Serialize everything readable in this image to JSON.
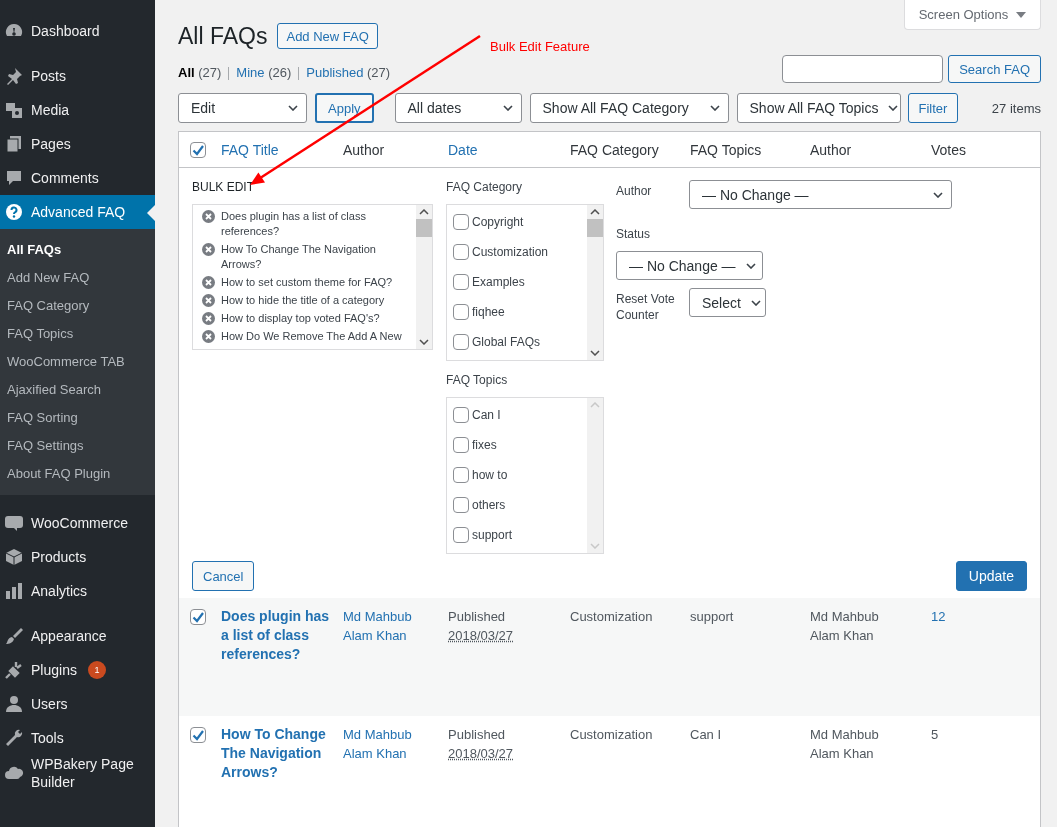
{
  "sidebar": {
    "groups": [
      {
        "items": [
          {
            "label": "Dashboard",
            "selected": false
          }
        ]
      },
      {
        "items": [
          {
            "label": "Posts",
            "selected": false
          },
          {
            "label": "Media",
            "selected": false
          },
          {
            "label": "Pages",
            "selected": false
          },
          {
            "label": "Comments",
            "selected": false
          },
          {
            "label": "Advanced FAQ",
            "selected": true,
            "children": [
              {
                "label": "All FAQs",
                "selected": true
              },
              {
                "label": "Add New FAQ",
                "selected": false
              },
              {
                "label": "FAQ Category",
                "selected": false
              },
              {
                "label": "FAQ Topics",
                "selected": false
              },
              {
                "label": "WooCommerce TAB",
                "selected": false
              },
              {
                "label": "Ajaxified Search",
                "selected": false
              },
              {
                "label": "FAQ Sorting",
                "selected": false
              },
              {
                "label": "FAQ Settings",
                "selected": false
              },
              {
                "label": "About FAQ Plugin",
                "selected": false
              }
            ]
          }
        ]
      },
      {
        "items": [
          {
            "label": "WooCommerce",
            "selected": false
          },
          {
            "label": "Products",
            "selected": false
          },
          {
            "label": "Analytics",
            "selected": false
          }
        ]
      },
      {
        "items": [
          {
            "label": "Appearance",
            "selected": false
          },
          {
            "label": "Plugins",
            "selected": false,
            "badge": "1"
          },
          {
            "label": "Users",
            "selected": false
          },
          {
            "label": "Tools",
            "selected": false
          },
          {
            "label": "WPBakery Page Builder",
            "selected": false
          }
        ]
      }
    ]
  },
  "screen_options": "Screen Options",
  "page_title": "All FAQs",
  "add_new_button": "Add New FAQ",
  "views": [
    {
      "label": "All",
      "count": "(27)",
      "selected": true
    },
    {
      "label": "Mine",
      "count": "(26)",
      "selected": false
    },
    {
      "label": "Published",
      "count": "(27)",
      "selected": false
    }
  ],
  "search_button": "Search FAQ",
  "filters": {
    "bulk_action": "Edit",
    "apply": "Apply",
    "dates": "All dates",
    "category": "Show All FAQ Category",
    "topics": "Show All FAQ Topics",
    "filter": "Filter",
    "items_count": "27 items"
  },
  "table": {
    "select_all_checked": true,
    "columns": [
      {
        "label": "FAQ Title",
        "sortable": true
      },
      {
        "label": "Author",
        "sortable": false
      },
      {
        "label": "Date",
        "sortable": true
      },
      {
        "label": "FAQ Category",
        "sortable": false
      },
      {
        "label": "FAQ Topics",
        "sortable": false
      },
      {
        "label": "Author",
        "sortable": false
      },
      {
        "label": "Votes",
        "sortable": false
      }
    ],
    "bulk_edit": {
      "title": "BULK EDIT",
      "posts": [
        "Does plugin has a list of class references?",
        "How To Change The Navigation Arrows?",
        "How to set custom theme for FAQ?",
        "How to hide the title of a category",
        "How to display top voted FAQ's?",
        "How Do We Remove The Add A New"
      ],
      "category_label": "FAQ Category",
      "categories": [
        {
          "label": "Copyright",
          "checked": false
        },
        {
          "label": "Customization",
          "checked": false
        },
        {
          "label": "Examples",
          "checked": false
        },
        {
          "label": "fiqhee",
          "checked": false
        },
        {
          "label": "Global FAQs",
          "checked": false
        }
      ],
      "topics_label": "FAQ Topics",
      "topics": [
        {
          "label": "Can I",
          "checked": false
        },
        {
          "label": "fixes",
          "checked": false
        },
        {
          "label": "how to",
          "checked": false
        },
        {
          "label": "others",
          "checked": false
        },
        {
          "label": "support",
          "checked": false
        }
      ],
      "author_label": "Author",
      "author_value": "— No Change —",
      "status_label": "Status",
      "status_value": "— No Change —",
      "reset_label": "Reset Vote Counter",
      "reset_value": "Select",
      "cancel": "Cancel",
      "update": "Update"
    },
    "rows": [
      {
        "checked": true,
        "title": "Does plugin has a list of class references?",
        "author": "Md Mahbub Alam Khan",
        "status": "Published",
        "date": "2018/03/27",
        "category": "Customization",
        "topics": "support",
        "author_2": "Md Mahbub Alam Khan",
        "votes": "12",
        "votes_linked": true
      },
      {
        "checked": true,
        "title": "How To Change The Navigation Arrows?",
        "author": "Md Mahbub Alam Khan",
        "status": "Published",
        "date": "2018/03/27",
        "category": "Customization",
        "topics": "Can I",
        "author_2": "Md Mahbub Alam Khan",
        "votes": "5",
        "votes_linked": false
      }
    ]
  },
  "annotation": {
    "text": "Bulk Edit Feature"
  }
}
